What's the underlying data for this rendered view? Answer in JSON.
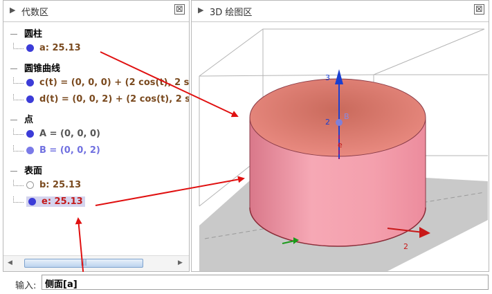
{
  "algebra": {
    "title": "代数区",
    "categories": [
      {
        "label": "圆柱",
        "items": [
          {
            "text": "a: 25.13"
          }
        ]
      },
      {
        "label": "圆锥曲线",
        "items": [
          {
            "text": "c(t) = (0, 0, 0) + (2 cos(t),  2 s"
          },
          {
            "text": "d(t) = (0, 0, 2) + (2 cos(t), 2 s"
          }
        ]
      },
      {
        "label": "点",
        "items": [
          {
            "text": "A = (0, 0, 0)"
          },
          {
            "text": "B = (0, 0, 2)"
          }
        ]
      },
      {
        "label": "表面",
        "items": [
          {
            "text": "b: 25.13"
          },
          {
            "text": "e: 25.13"
          }
        ]
      }
    ]
  },
  "graphics3d": {
    "title": "3D 绘图区",
    "axis_labels": {
      "z3": "3",
      "z2": "2",
      "x2": "2"
    },
    "point_label": "B",
    "object_label": "e"
  },
  "input": {
    "label": "输入:",
    "value": "侧面[a]"
  },
  "colors": {
    "cylinder_side": "#f29aa6",
    "cylinder_top": "#e8847a",
    "arrow": "#e01010",
    "z_axis": "#1a3fd0"
  }
}
